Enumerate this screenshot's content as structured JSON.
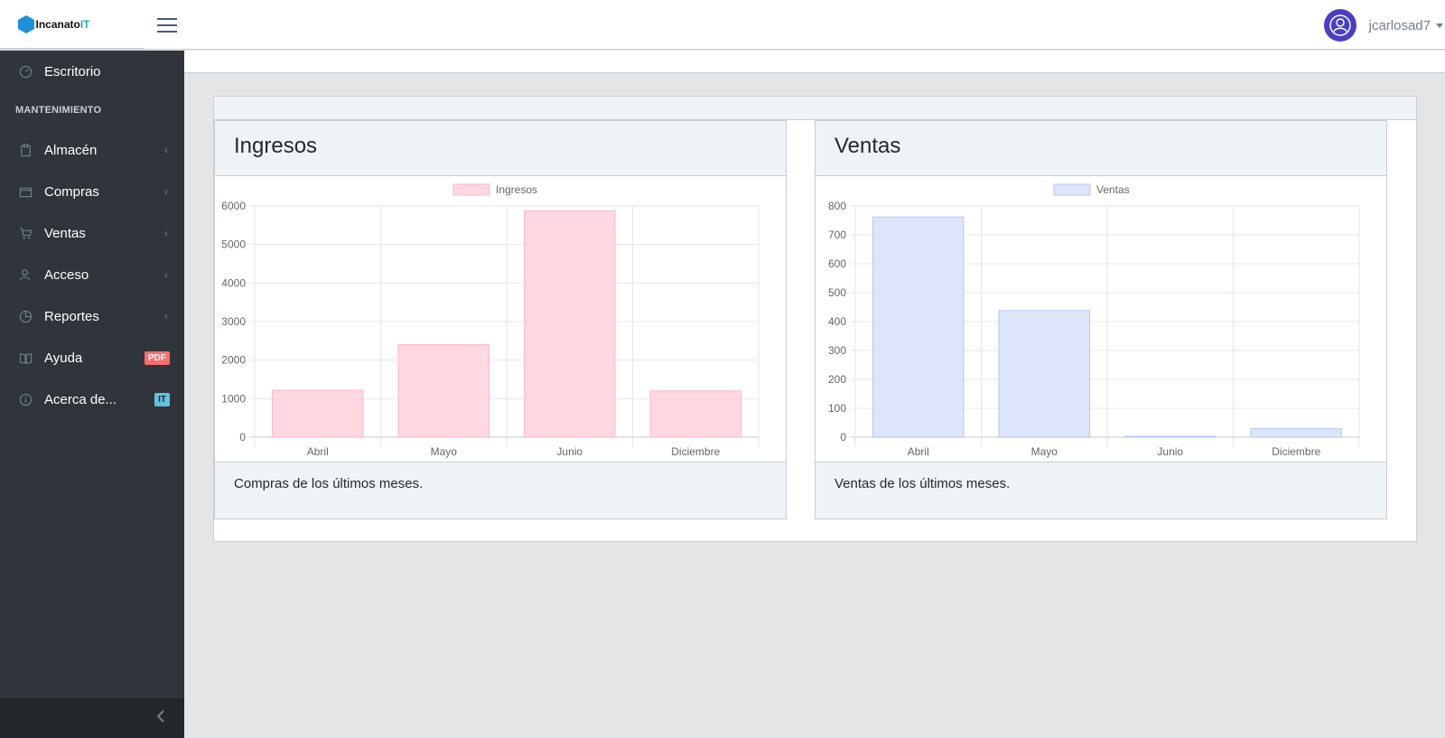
{
  "header": {
    "brand_name": "Incanato",
    "brand_suffix": "IT",
    "username": "jcarlosad7"
  },
  "sidebar": {
    "section_title": "MANTENIMIENTO",
    "items": [
      {
        "label": "Escritorio",
        "icon": "speedometer-icon"
      },
      {
        "label": "Almacén",
        "icon": "clipboard-icon"
      },
      {
        "label": "Compras",
        "icon": "wallet-icon"
      },
      {
        "label": "Ventas",
        "icon": "cart-icon"
      },
      {
        "label": "Acceso",
        "icon": "users-icon"
      },
      {
        "label": "Reportes",
        "icon": "pie-chart-icon"
      },
      {
        "label": "Ayuda",
        "icon": "book-icon",
        "badge": "PDF"
      },
      {
        "label": "Acerca de...",
        "icon": "info-icon",
        "badge": "IT"
      }
    ]
  },
  "cards": [
    {
      "title": "Ingresos",
      "footer": "Compras de los últimos meses."
    },
    {
      "title": "Ventas",
      "footer": "Ventas de los últimos meses."
    }
  ],
  "chart_data": [
    {
      "type": "bar",
      "categories": [
        "Abril",
        "Mayo",
        "Junio",
        "Diciembre"
      ],
      "series": [
        {
          "name": "Ingresos",
          "values": [
            1220,
            2400,
            5870,
            1200
          ]
        }
      ],
      "ylim": [
        0,
        6000
      ],
      "yticks": [
        0,
        1000,
        2000,
        3000,
        4000,
        5000,
        6000
      ],
      "legend_position": "top",
      "colors": {
        "fill": "#ffd8e1",
        "stroke": "#ffb6c6"
      },
      "grid": true
    },
    {
      "type": "bar",
      "categories": [
        "Abril",
        "Mayo",
        "Junio",
        "Diciembre"
      ],
      "series": [
        {
          "name": "Ventas",
          "values": [
            762,
            438,
            3,
            30
          ]
        }
      ],
      "ylim": [
        0,
        800
      ],
      "yticks": [
        0,
        100,
        200,
        300,
        400,
        500,
        600,
        700,
        800
      ],
      "legend_position": "top",
      "colors": {
        "fill": "#dde5fb",
        "stroke": "#b7c6f5"
      },
      "grid": true
    }
  ]
}
